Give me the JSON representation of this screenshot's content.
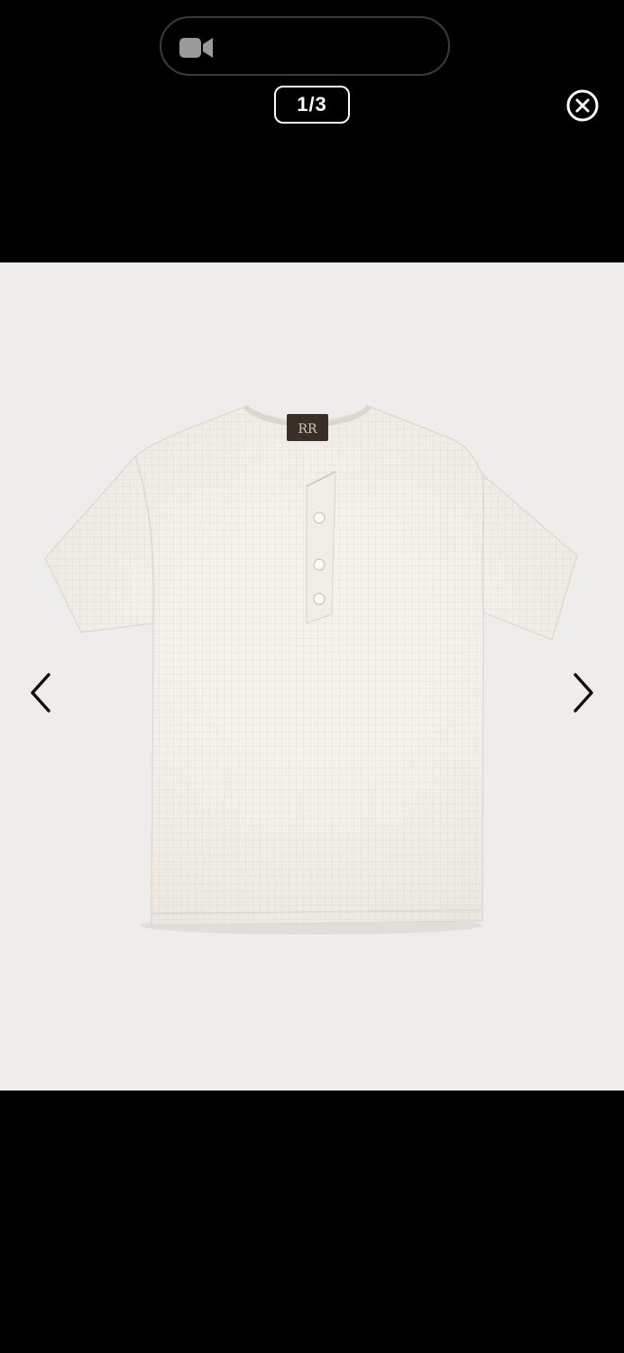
{
  "header": {
    "counter_text": "1/3"
  },
  "icons": {
    "video": "video-camera-icon",
    "close": "close-circle-icon",
    "prev": "chevron-left-icon",
    "next": "chevron-right-icon"
  },
  "colors": {
    "background": "#000000",
    "image_background": "#eeedeb",
    "product": "#f4f2ec",
    "icon_grey": "#9a9a9a"
  }
}
